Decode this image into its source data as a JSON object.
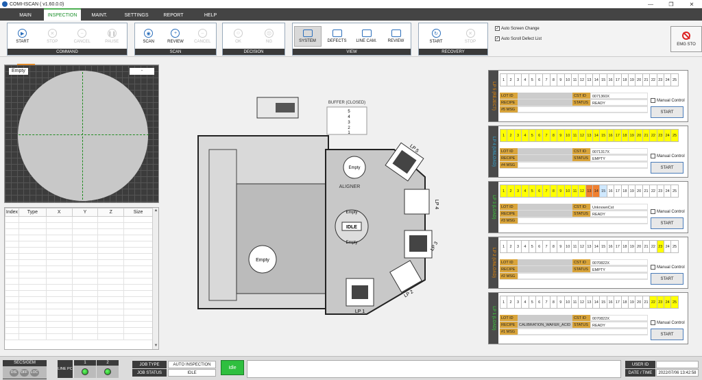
{
  "window": {
    "title": "COMI-ISCAN ( v1.60.0.0)"
  },
  "menu": [
    {
      "label": "MAIN"
    },
    {
      "label": "INSPECTION",
      "active": true
    },
    {
      "label": "MAINT."
    },
    {
      "label": "SETTINGS"
    },
    {
      "label": "REPORT"
    },
    {
      "label": "HELP"
    }
  ],
  "ribbon": {
    "command": {
      "title": "COMMAND",
      "buttons": [
        {
          "label": "START",
          "icon": "play-icon",
          "enabled": true
        },
        {
          "label": "STOP",
          "icon": "stop-icon",
          "enabled": false
        },
        {
          "label": "CANCEL",
          "icon": "cancel-icon",
          "enabled": false
        },
        {
          "label": "PAUSE",
          "icon": "pause-icon",
          "enabled": false
        }
      ]
    },
    "scan": {
      "title": "SCAN",
      "buttons": [
        {
          "label": "SCAN",
          "icon": "scan-icon",
          "enabled": true
        },
        {
          "label": "REVIEW",
          "icon": "zoom-in-icon",
          "enabled": true
        },
        {
          "label": "CANCEL",
          "icon": "zoom-out-icon",
          "enabled": false
        }
      ]
    },
    "decision": {
      "title": "DECISION",
      "buttons": [
        {
          "label": "OK",
          "icon": "smile-icon",
          "enabled": false
        },
        {
          "label": "NG",
          "icon": "frown-icon",
          "enabled": false
        }
      ]
    },
    "view": {
      "title": "VIEW",
      "buttons": [
        {
          "label": "SYSTEM",
          "icon": "monitor-icon",
          "enabled": true,
          "selected": true
        },
        {
          "label": "DEFECTS",
          "icon": "defects-icon",
          "enabled": true
        },
        {
          "label": "LINE CAM.",
          "icon": "camera-icon",
          "enabled": true
        },
        {
          "label": "REVIEW",
          "icon": "review-icon",
          "enabled": true
        }
      ]
    },
    "recovery": {
      "title": "RECOVERY",
      "buttons": [
        {
          "label": "START",
          "icon": "recovery-start-icon",
          "enabled": true
        },
        {
          "label": "STOP",
          "icon": "recovery-stop-icon",
          "enabled": false
        }
      ]
    },
    "options": [
      {
        "label": "Auto Screen Change",
        "checked": true
      },
      {
        "label": "Auto Scroll Defect List",
        "checked": true
      }
    ],
    "emg": "EMG STO"
  },
  "wafer_map": {
    "left_label": "Empty",
    "right_label": "-"
  },
  "defect_table": {
    "columns": [
      "Index",
      "Type",
      "X",
      "Y",
      "Z",
      "Size"
    ]
  },
  "equipment": {
    "buffer_title": "BUFFER (CLOSED)",
    "buffer_slots": [
      "5",
      "4",
      "3",
      "2",
      "1"
    ],
    "aligner": "ALIGNER",
    "idle": "IDLE",
    "empty": "Empty",
    "lp_labels": [
      "LP 1",
      "LP 2",
      "LP 3",
      "LP 4",
      "LP 5"
    ]
  },
  "loadports": [
    {
      "name": "LP 5 (REJECT)",
      "color": "#c07a1a",
      "yellow": [],
      "orange": [],
      "blue": [],
      "lot_id": "",
      "cst_id": "0071360X",
      "recipe": "",
      "status": "READY",
      "msg": "#5 MSG"
    },
    {
      "name": "LP 4 (UNLOAD)",
      "color": "#3a8fb0",
      "yellow": [
        1,
        2,
        3,
        4,
        5,
        6,
        7,
        8,
        9,
        10,
        11,
        12,
        13,
        14,
        15,
        16,
        17,
        18,
        19,
        20,
        21,
        22,
        23,
        24,
        25
      ],
      "orange": [],
      "blue": [],
      "lot_id": "",
      "cst_id": "0071317X",
      "recipe": "",
      "status": "EMPTY",
      "msg": "#4 MSG"
    },
    {
      "name": "LP 3 (LOAD)",
      "color": "#40b040",
      "yellow": [
        1,
        2,
        3,
        4,
        5,
        6,
        7,
        8,
        9,
        10,
        11,
        12
      ],
      "orange": [
        13,
        14
      ],
      "blue": [
        15
      ],
      "lot_id": "",
      "cst_id": "UnknownCst",
      "recipe": "",
      "status": "READY",
      "msg": "#3 MSG"
    },
    {
      "name": "LP 2 (UNLOAD)",
      "color": "#c07a1a",
      "yellow": [
        23
      ],
      "orange": [],
      "blue": [],
      "lot_id": "",
      "cst_id": "0070822X",
      "recipe": "",
      "status": "EMPTY",
      "msg": "#2 MSG"
    },
    {
      "name": "LP 1 (LOAD)",
      "color": "#40b040",
      "yellow": [
        22,
        23,
        24,
        25
      ],
      "orange": [],
      "blue": [],
      "lot_id": "",
      "cst_id": "0070822X",
      "recipe": "CALIBRATION_WAFER_ACID",
      "status": "READY",
      "msg": "#1 MSG"
    }
  ],
  "loadport_labels": {
    "lot_id": "LOT ID",
    "cst_id": "CST ID",
    "recipe": "RECIPE",
    "status": "STATUS",
    "manual": "Manual Control",
    "start": "START"
  },
  "status": {
    "secs_title": "SECS/GEM",
    "secs_buttons": [
      "DIS",
      "OFF",
      "LOC"
    ],
    "line_pc": "LINE PC",
    "pc_nums": [
      "1",
      "2"
    ],
    "job_type_label": "JOB TYPE",
    "job_type": "AUTO INSPECTION",
    "job_status_label": "JOB STATUS",
    "job_status": "IDLE",
    "state": "Idle",
    "user_label": "USER ID",
    "user": "",
    "datetime_label": "DATE / TIME",
    "datetime": "2022/07/06 13:42:58"
  }
}
